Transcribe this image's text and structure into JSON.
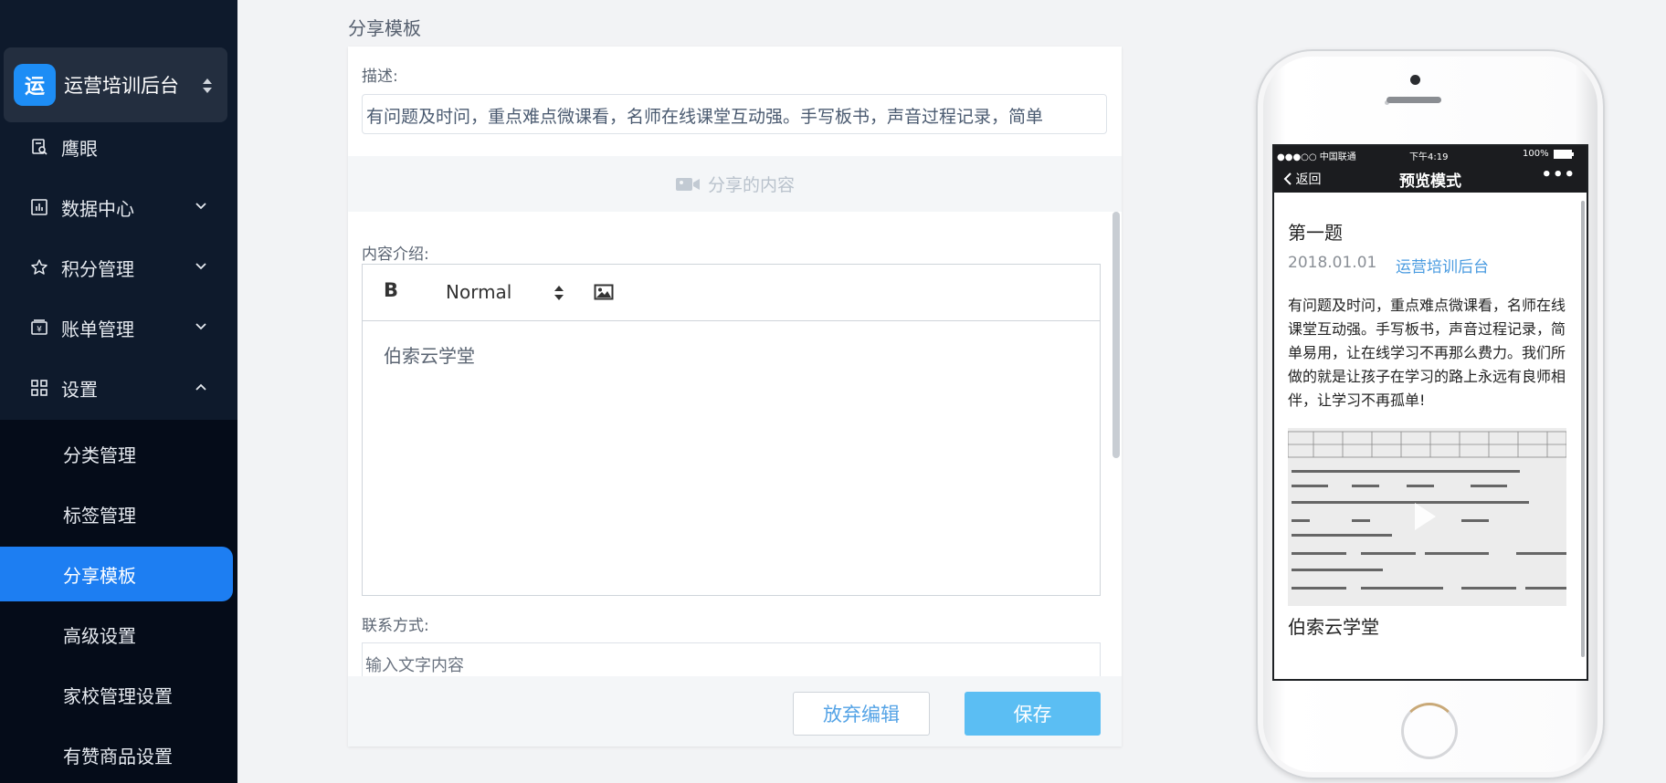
{
  "sidebar": {
    "app": {
      "logo_text": "运",
      "name": "运营培训后台"
    },
    "items": [
      {
        "label": "鹰眼",
        "icon": "doc-search-icon"
      },
      {
        "label": "数据中心",
        "icon": "chart-icon"
      },
      {
        "label": "积分管理",
        "icon": "star-icon"
      },
      {
        "label": "账单管理",
        "icon": "bill-icon"
      },
      {
        "label": "设置",
        "icon": "grid-icon"
      }
    ],
    "submenu": [
      {
        "label": "分类管理"
      },
      {
        "label": "标签管理"
      },
      {
        "label": "分享模板"
      },
      {
        "label": "高级设置"
      },
      {
        "label": "家校管理设置"
      },
      {
        "label": "有赞商品设置"
      }
    ]
  },
  "main": {
    "title": "分享模板",
    "desc_label": "描述:",
    "desc_value": "有问题及时问，重点难点微课看，名师在线课堂互动强。手写板书，声音过程记录，简单",
    "share_bar_label": "分享的内容",
    "intro_label": "内容介绍:",
    "editor": {
      "bold": "B",
      "format": "Normal",
      "content": "伯索云学堂"
    },
    "contact_label": "联系方式:",
    "contact_value": "输入文字内容",
    "discard_label": "放弃编辑",
    "save_label": "保存"
  },
  "preview": {
    "status": {
      "carrier": "●●●○○ 中国联通",
      "time": "下午4:19",
      "battery": "100%"
    },
    "nav": {
      "back": "返回",
      "title": "预览模式",
      "more": "•••"
    },
    "title": "第一题",
    "date": "2018.01.01",
    "author": "运营培训后台",
    "body": "有问题及时问，重点难点微课看，名师在线课堂互动强。手写板书，声音过程记录，简单易用，让在线学习不再那么费力。我们所做的就是让孩子在学习的路上永远有良师相伴，让学习不再孤单!",
    "caption": "伯索云学堂"
  }
}
